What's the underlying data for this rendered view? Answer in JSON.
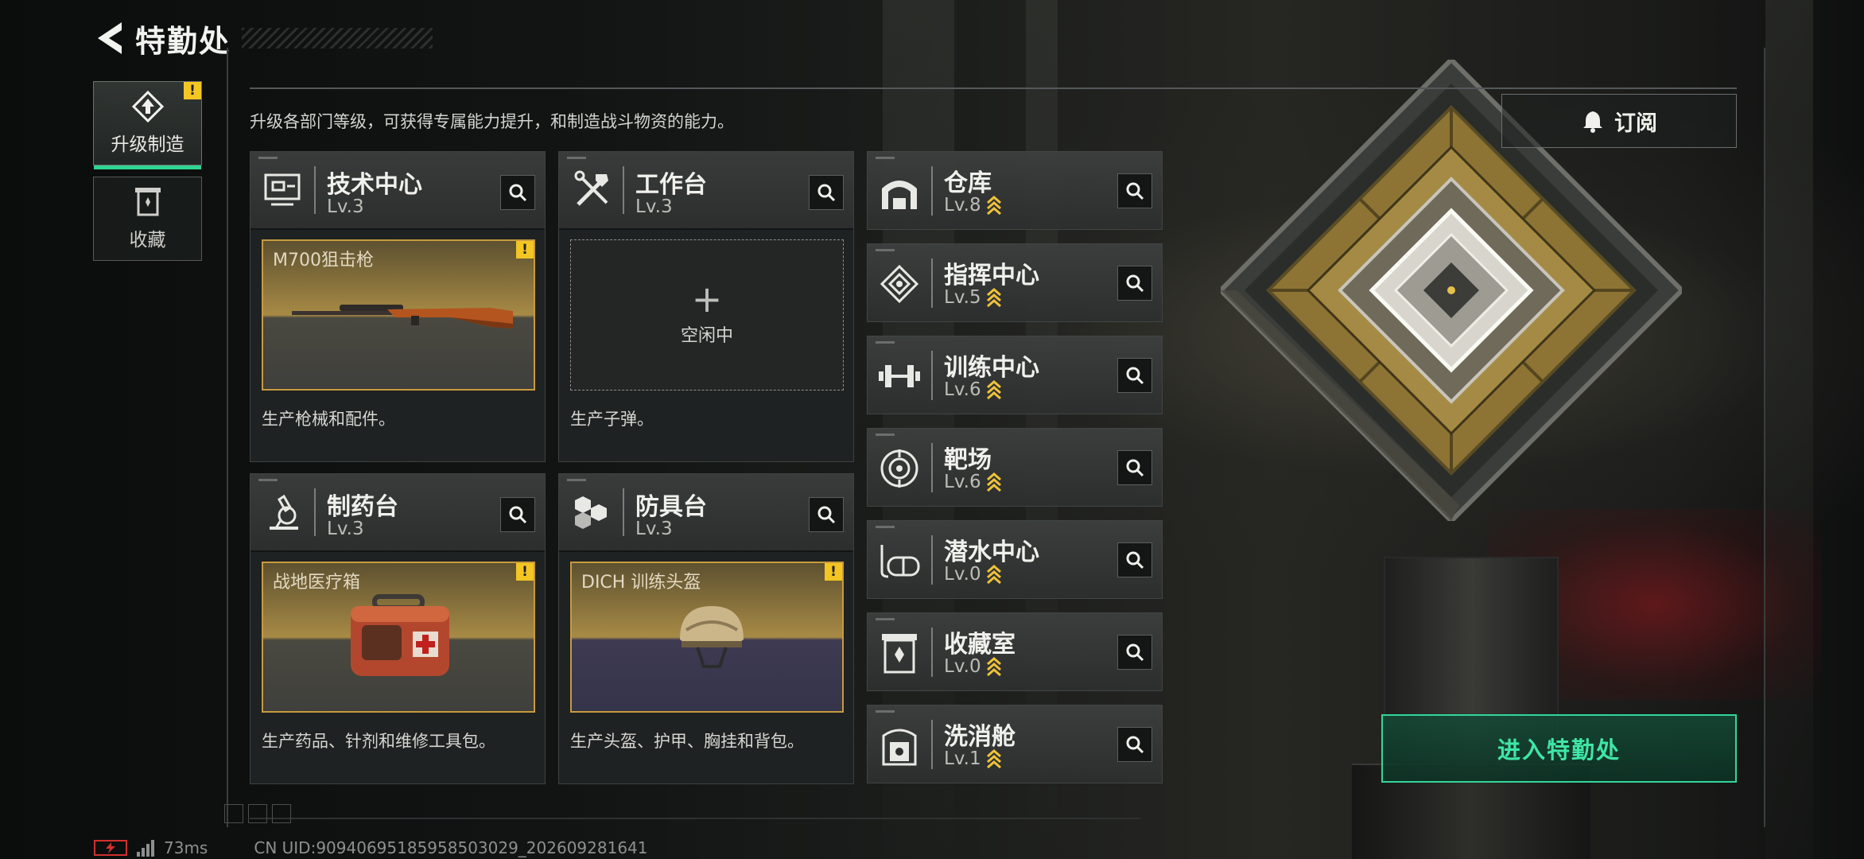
{
  "header": {
    "title": "特勤处",
    "back_icon": "back-arrow-icon"
  },
  "sidenav": [
    {
      "label": "升级制造",
      "icon": "upgrade-icon",
      "active": true,
      "alert": "!"
    },
    {
      "label": "收藏",
      "icon": "collection-icon",
      "active": false
    }
  ],
  "description": "升级各部门等级，可获得专属能力提升，和制造战斗物资的能力。",
  "workshops": [
    {
      "name": "技术中心",
      "level": "Lv.3",
      "icon": "tech-center-icon",
      "slot_state": "producing",
      "slot_item": "M700狙击枪",
      "alert": "!",
      "desc": "生产枪械和配件。"
    },
    {
      "name": "工作台",
      "level": "Lv.3",
      "icon": "workbench-icon",
      "slot_state": "idle",
      "idle_plus": "+",
      "idle_text": "空闲中",
      "desc": "生产子弹。"
    },
    {
      "name": "制药台",
      "level": "Lv.3",
      "icon": "pharmacy-icon",
      "slot_state": "producing",
      "slot_item": "战地医疗箱",
      "alert": "!",
      "desc": "生产药品、针剂和维修工具包。"
    },
    {
      "name": "防具台",
      "level": "Lv.3",
      "icon": "armor-bench-icon",
      "slot_state": "producing",
      "slot_item": "DICH 训练头盔",
      "alert": "!",
      "desc": "生产头盔、护甲、胸挂和背包。"
    }
  ],
  "facilities": [
    {
      "name": "仓库",
      "level": "Lv.8",
      "icon": "warehouse-icon",
      "upgradable": true
    },
    {
      "name": "指挥中心",
      "level": "Lv.5",
      "icon": "command-center-icon",
      "upgradable": true
    },
    {
      "name": "训练中心",
      "level": "Lv.6",
      "icon": "training-center-icon",
      "upgradable": true
    },
    {
      "name": "靶场",
      "level": "Lv.6",
      "icon": "shooting-range-icon",
      "upgradable": true
    },
    {
      "name": "潜水中心",
      "level": "Lv.0",
      "icon": "diving-center-icon",
      "upgradable": true
    },
    {
      "name": "收藏室",
      "level": "Lv.0",
      "icon": "collection-room-icon",
      "upgradable": true
    },
    {
      "name": "洗消舱",
      "level": "Lv.1",
      "icon": "decontamination-icon",
      "upgradable": true
    }
  ],
  "subscribe": {
    "label": "订阅",
    "icon": "bell-icon"
  },
  "enter_button": {
    "label": "进入特勤处"
  },
  "status_bar": {
    "ping": "73ms",
    "uid": "CN UID:9094069518595850302​9_202609281641"
  },
  "colors": {
    "accent_green": "#34d69b",
    "alert_yellow": "#f3c623",
    "upgrade_chevron": "#f0c23a",
    "slot_border": "#c89a3e"
  }
}
